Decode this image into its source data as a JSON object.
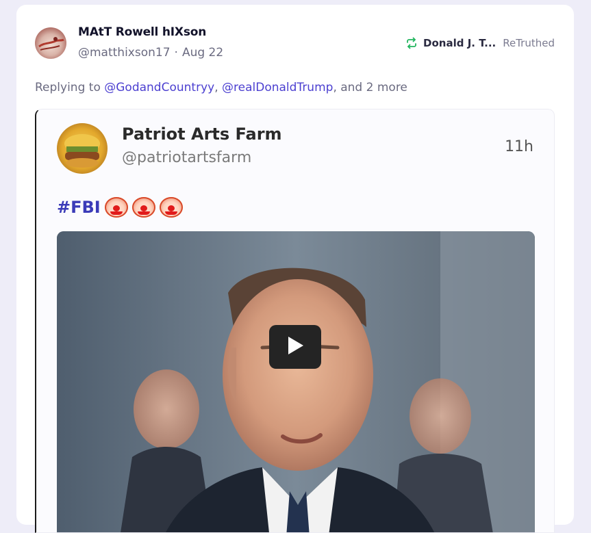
{
  "post": {
    "display_name": "MAtT Rowell hIXson",
    "handle": "@matthixson17",
    "separator": "·",
    "date": "Aug 22",
    "retruthed_by": "Donald J. T...",
    "retruthed_label": "ReTruthed",
    "reply_prefix": "Replying to",
    "mention_1": "@GodandCountryy",
    "comma": ",",
    "mention_2": "@realDonaldTrump",
    "reply_suffix": ", and 2 more"
  },
  "embedded": {
    "name": "Patriot Arts Farm",
    "handle": "@patriotartsfarm",
    "time": "11h",
    "hashtag": "#FBI",
    "emoji_count": 3
  },
  "colors": {
    "background": "#eeedf8",
    "mention": "#4b3fd0",
    "retruth_icon": "#22b55e",
    "hashtag": "#3b3bb8"
  },
  "icons": {
    "retruth": "retruth-arrows-icon",
    "play": "play-icon",
    "clown": "clown-face-emoji"
  }
}
